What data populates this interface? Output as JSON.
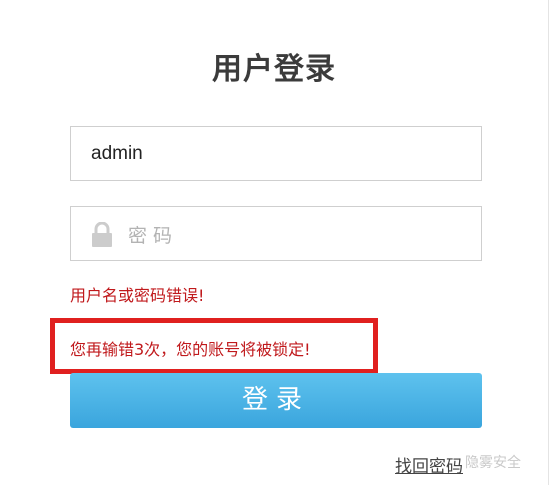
{
  "login": {
    "title": "用户登录",
    "username_value": "admin",
    "password_placeholder": "密码",
    "error_message": "用户名或密码错误!",
    "warning_message": "您再输错3次，您的账号将被锁定!",
    "submit_label": "登录",
    "forgot_password_label": "找回密码"
  },
  "watermark": "隐雾安全",
  "colors": {
    "error": "#c0191c",
    "highlight_border": "#e0201f",
    "button": "#4ab4e6"
  },
  "icons": {
    "password": "lock-icon"
  }
}
